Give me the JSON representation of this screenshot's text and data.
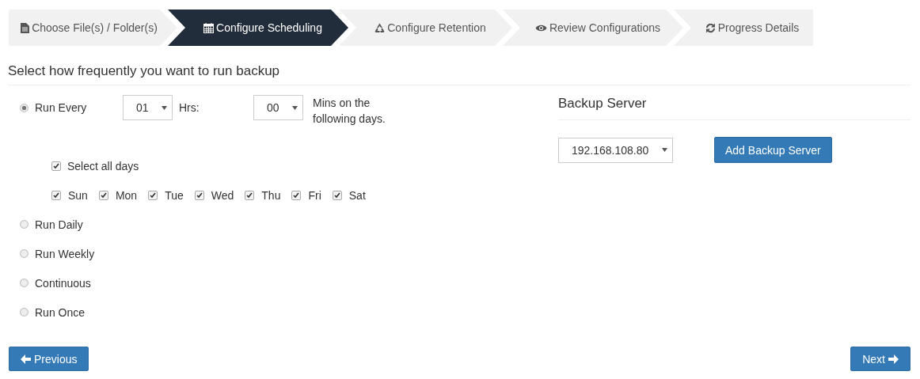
{
  "steps": [
    {
      "label": "Choose File(s) / Folder(s)",
      "kind": "file",
      "selected": false
    },
    {
      "label": "Configure Scheduling",
      "kind": "calendar",
      "selected": true
    },
    {
      "label": "Configure Retention",
      "kind": "recycle",
      "selected": false
    },
    {
      "label": "Review Configurations",
      "kind": "eye",
      "selected": false
    },
    {
      "label": "Progress Details",
      "kind": "refresh",
      "selected": false
    }
  ],
  "heading": "Select how frequently you want to run backup",
  "schedule_options": [
    {
      "label": "Run Every",
      "selected": true,
      "kind": "interval"
    },
    {
      "label": "Run Daily",
      "selected": false,
      "kind": "plain"
    },
    {
      "label": "Run Weekly",
      "selected": false,
      "kind": "plain"
    },
    {
      "label": "Continuous",
      "selected": false,
      "kind": "plain"
    },
    {
      "label": "Run Once",
      "selected": false,
      "kind": "plain"
    }
  ],
  "interval": {
    "hours": "01",
    "hours_label": "Hrs:",
    "minutes": "00",
    "minutes_label": "Mins on the following days.",
    "select_all": {
      "label": "Select all days",
      "checked": true
    },
    "days": [
      {
        "label": "Sun",
        "checked": true
      },
      {
        "label": "Mon",
        "checked": true
      },
      {
        "label": "Tue",
        "checked": true
      },
      {
        "label": "Wed",
        "checked": true
      },
      {
        "label": "Thu",
        "checked": true
      },
      {
        "label": "Fri",
        "checked": true
      },
      {
        "label": "Sat",
        "checked": true
      }
    ]
  },
  "backup_server": {
    "title": "Backup Server",
    "server": "192.168.108.80",
    "add_button": "Add Backup Server"
  },
  "buttons": {
    "previous": "Previous",
    "next": "Next"
  }
}
